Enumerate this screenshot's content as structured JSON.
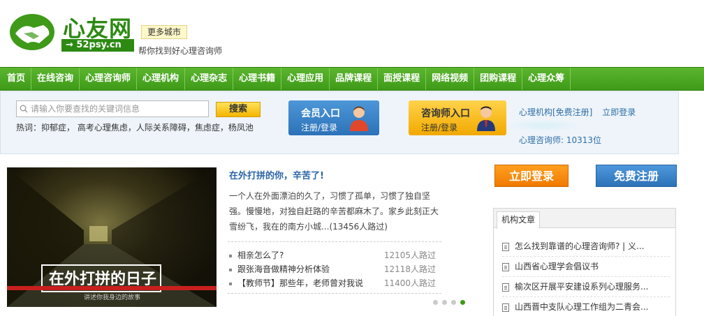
{
  "brand": {
    "name": "心友网",
    "domain": "→ 52psy.cn",
    "city_button": "更多城市",
    "slogan": "帮你找到好心理咨询师"
  },
  "nav": [
    "首页",
    "在线咨询",
    "心理咨询师",
    "心理机构",
    "心理杂志",
    "心理书籍",
    "心理应用",
    "品牌课程",
    "面授课程",
    "网络视频",
    "团购课程",
    "心理众筹"
  ],
  "search": {
    "placeholder": "请输入你要查找的关键词信息",
    "button": "搜索",
    "hot_label": "热词：",
    "hot_words": "抑郁症， 高考心理焦虑，人际关系障碍，焦虑症，杨凤池"
  },
  "member": {
    "title": "会员入口",
    "sub": "注册/登录"
  },
  "consultant": {
    "title": "咨询师入口",
    "sub": "注册/登录"
  },
  "side_links": {
    "institution": "心理机构[免费注册]",
    "login": "立即登录",
    "count": "心理咨询师: 10313位"
  },
  "feature": {
    "image_caption": "在外打拼的日子",
    "image_sub": "讲述你我身边的故事",
    "title": "在外打拼的你，辛苦了!",
    "summary": "一个人在外面漂泊的久了，习惯了孤单，习惯了独自坚强。慢慢地，对独自赶路的辛苦都麻木了。家乡此刻正大雪纷飞，我在的南方小城...(13456人路过)"
  },
  "article_list": [
    {
      "title": "相亲怎么了?",
      "count": "12105人路过"
    },
    {
      "title": "跟张海音做精神分析体验",
      "count": "12118人路过"
    },
    {
      "title": "【教师节】那些年，老师曾对我说",
      "count": "11400人路过"
    }
  ],
  "right": {
    "login": "立即登录",
    "register": "免费注册"
  },
  "org_articles": {
    "tab": "机构文章",
    "items": [
      "怎么找到靠谱的心理咨询师? | 义...",
      "山西省心理学会倡议书",
      "榆次区开展平安建设系列心理服务...",
      "山西晋中支队心理工作组为二青会..."
    ]
  },
  "colors": {
    "brand_green": "#3e9a18",
    "link_blue": "#2a64a6",
    "login_orange": "#f07a00",
    "register_blue": "#2c72b8"
  }
}
